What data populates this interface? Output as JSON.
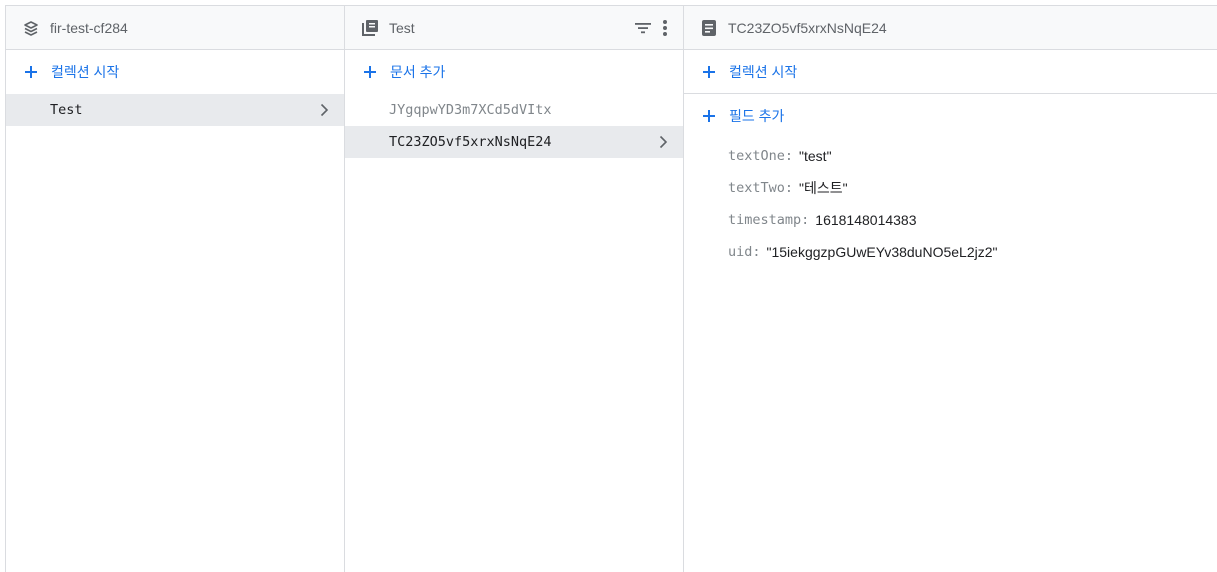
{
  "colors": {
    "accent": "#1a73e8",
    "selected_bg": "#e8eaed",
    "header_bg": "#f8f9fa"
  },
  "root_panel": {
    "title": "fir-test-cf284",
    "icon": "firestore-stack-icon",
    "add_collection_label": "컬렉션 시작",
    "collections": [
      {
        "label": "Test",
        "selected": true
      }
    ]
  },
  "collection_panel": {
    "title": "Test",
    "icon": "collection-icon",
    "filter_icon": "filter-list-icon",
    "menu_icon": "more-vert-icon",
    "add_document_label": "문서 추가",
    "documents": [
      {
        "label": "JYgqpwYD3m7XCd5dVItx",
        "selected": false
      },
      {
        "label": "TC23ZO5vf5xrxNsNqE24",
        "selected": true
      }
    ]
  },
  "document_panel": {
    "title": "TC23ZO5vf5xrxNsNqE24",
    "icon": "document-icon",
    "add_collection_label": "컬렉션 시작",
    "add_field_label": "필드 추가",
    "fields": [
      {
        "key": "textOne:",
        "value": "\"test\""
      },
      {
        "key": "textTwo:",
        "value": "\"테스트\""
      },
      {
        "key": "timestamp:",
        "value": "1618148014383"
      },
      {
        "key": "uid:",
        "value": "\"15iekggzpGUwEYv38duNO5eL2jz2\""
      }
    ]
  }
}
